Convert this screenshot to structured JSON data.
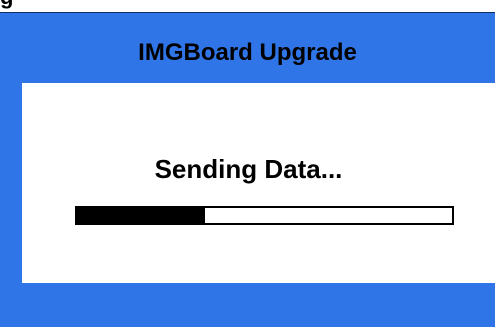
{
  "top_label": "g",
  "window": {
    "title": "IMGBoard Upgrade"
  },
  "dialog": {
    "status_text": "Sending Data...",
    "progress_fraction": 0.34
  },
  "colors": {
    "background": "#2f75e8",
    "panel": "#ffffff",
    "progress_fill": "#000000"
  }
}
